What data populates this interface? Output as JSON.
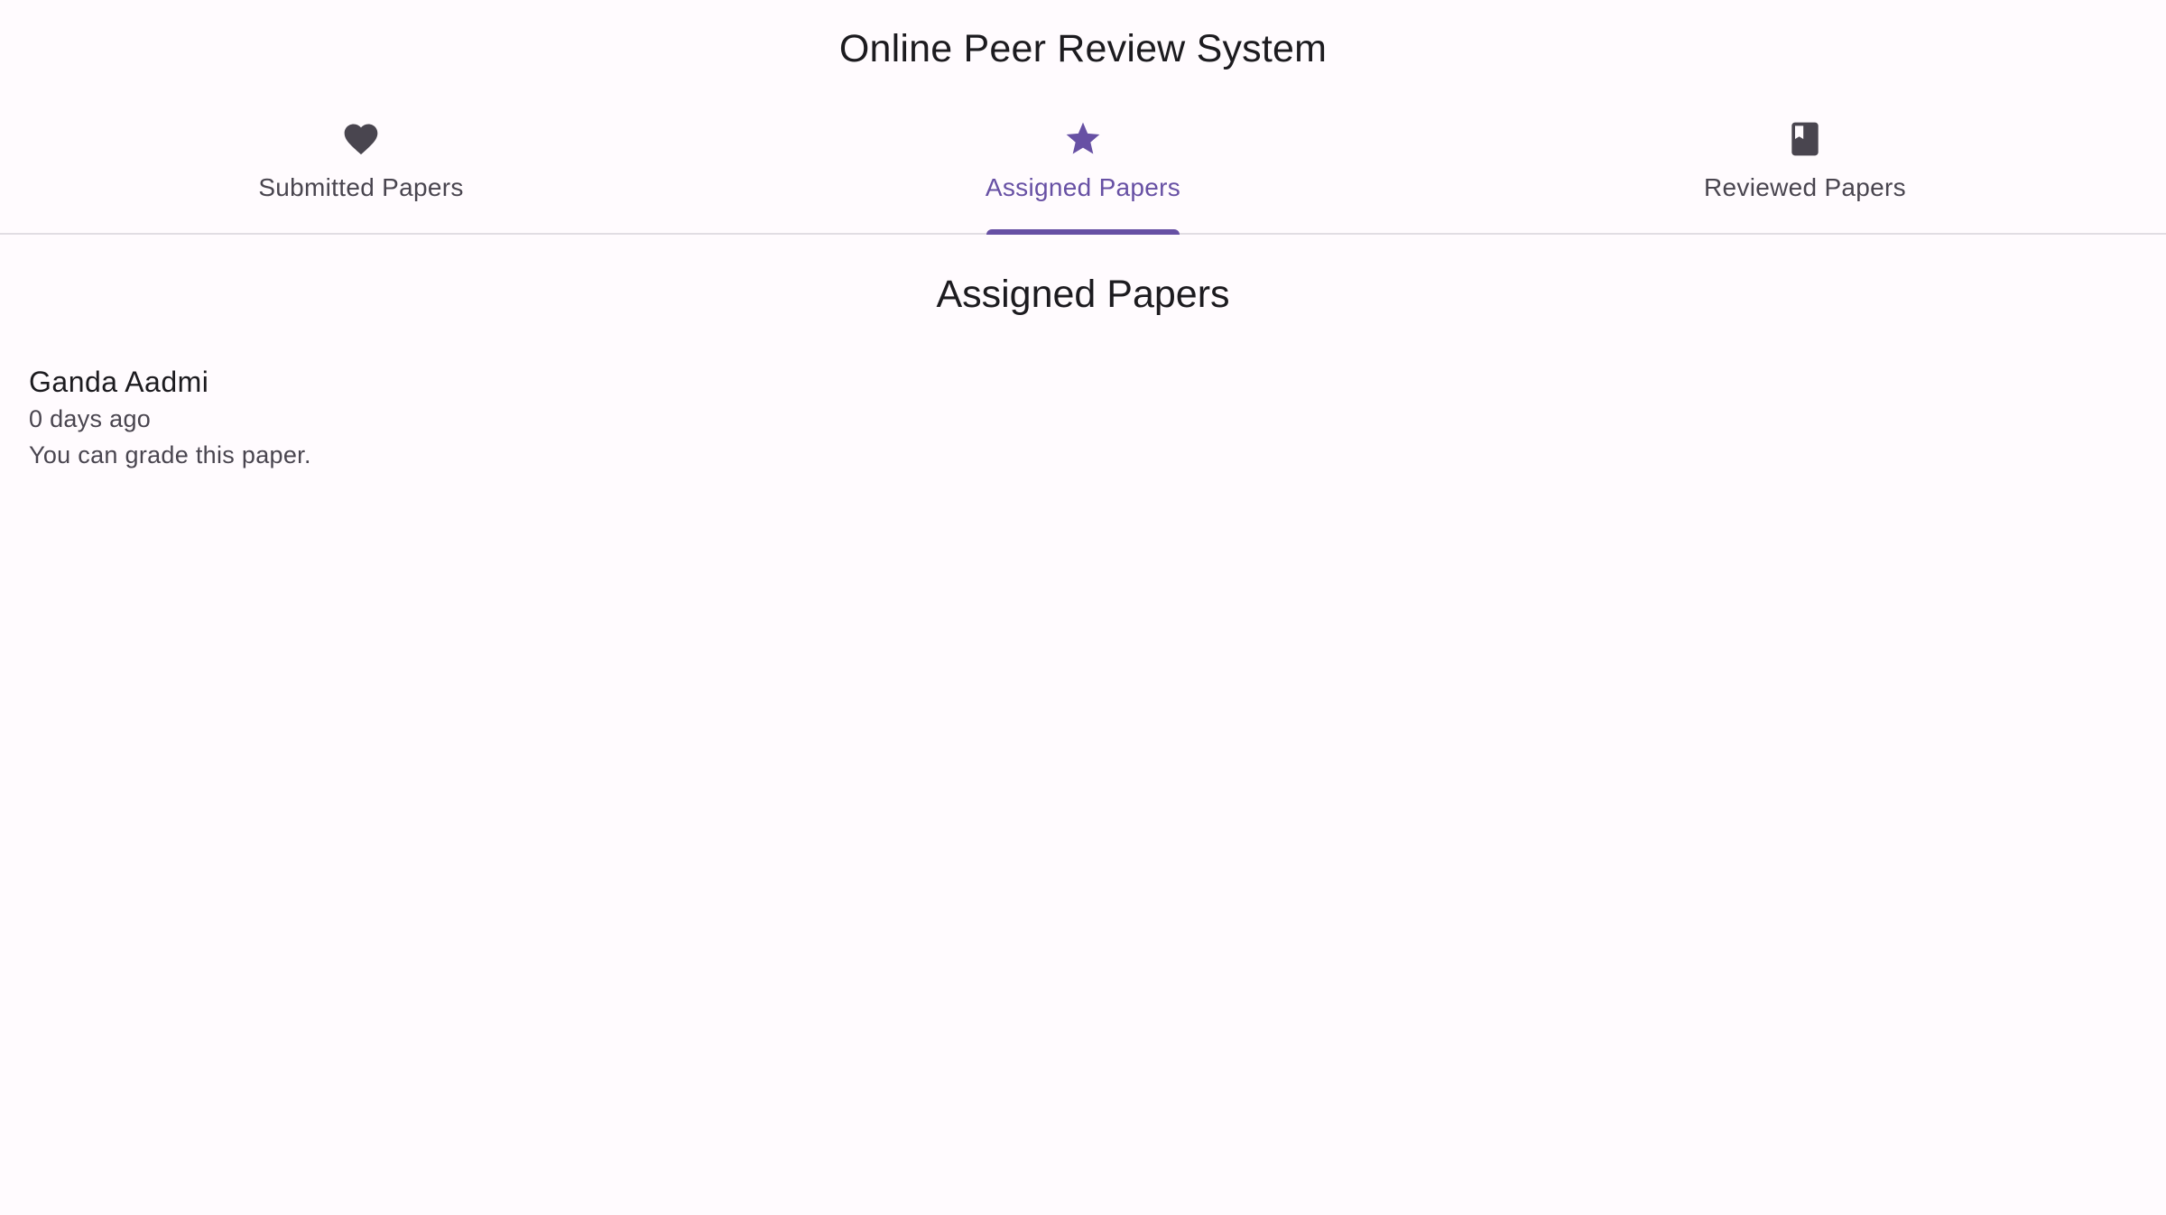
{
  "app": {
    "title": "Online Peer Review System"
  },
  "tabs": [
    {
      "label": "Submitted Papers",
      "icon": "heart-icon",
      "active": false
    },
    {
      "label": "Assigned Papers",
      "icon": "star-icon",
      "active": true
    },
    {
      "label": "Reviewed Papers",
      "icon": "book-icon",
      "active": false
    }
  ],
  "main": {
    "section_title": "Assigned Papers",
    "papers": [
      {
        "author": "Ganda Aadmi",
        "time": "0 days ago",
        "status": "You can grade this paper."
      }
    ]
  },
  "colors": {
    "accent": "#6750a4",
    "icon_default": "#49454f",
    "background": "#fffbfe"
  }
}
